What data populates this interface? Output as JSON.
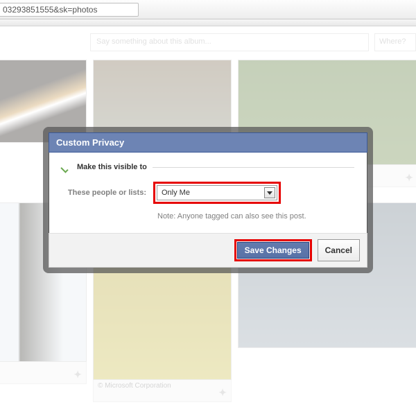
{
  "browser": {
    "url_fragment": "03293851555&sk=photos"
  },
  "composer": {
    "placeholder": "Say something about this album...",
    "where_placeholder": "Where?"
  },
  "captions": {
    "author": "© Microsoft Corporation"
  },
  "dialog": {
    "title": "Custom Privacy",
    "section_label": "Make this visible to",
    "row_label": "These people or lists:",
    "select_value": "Only Me",
    "note": "Note: Anyone tagged can also see this post.",
    "save_label": "Save Changes",
    "cancel_label": "Cancel"
  }
}
